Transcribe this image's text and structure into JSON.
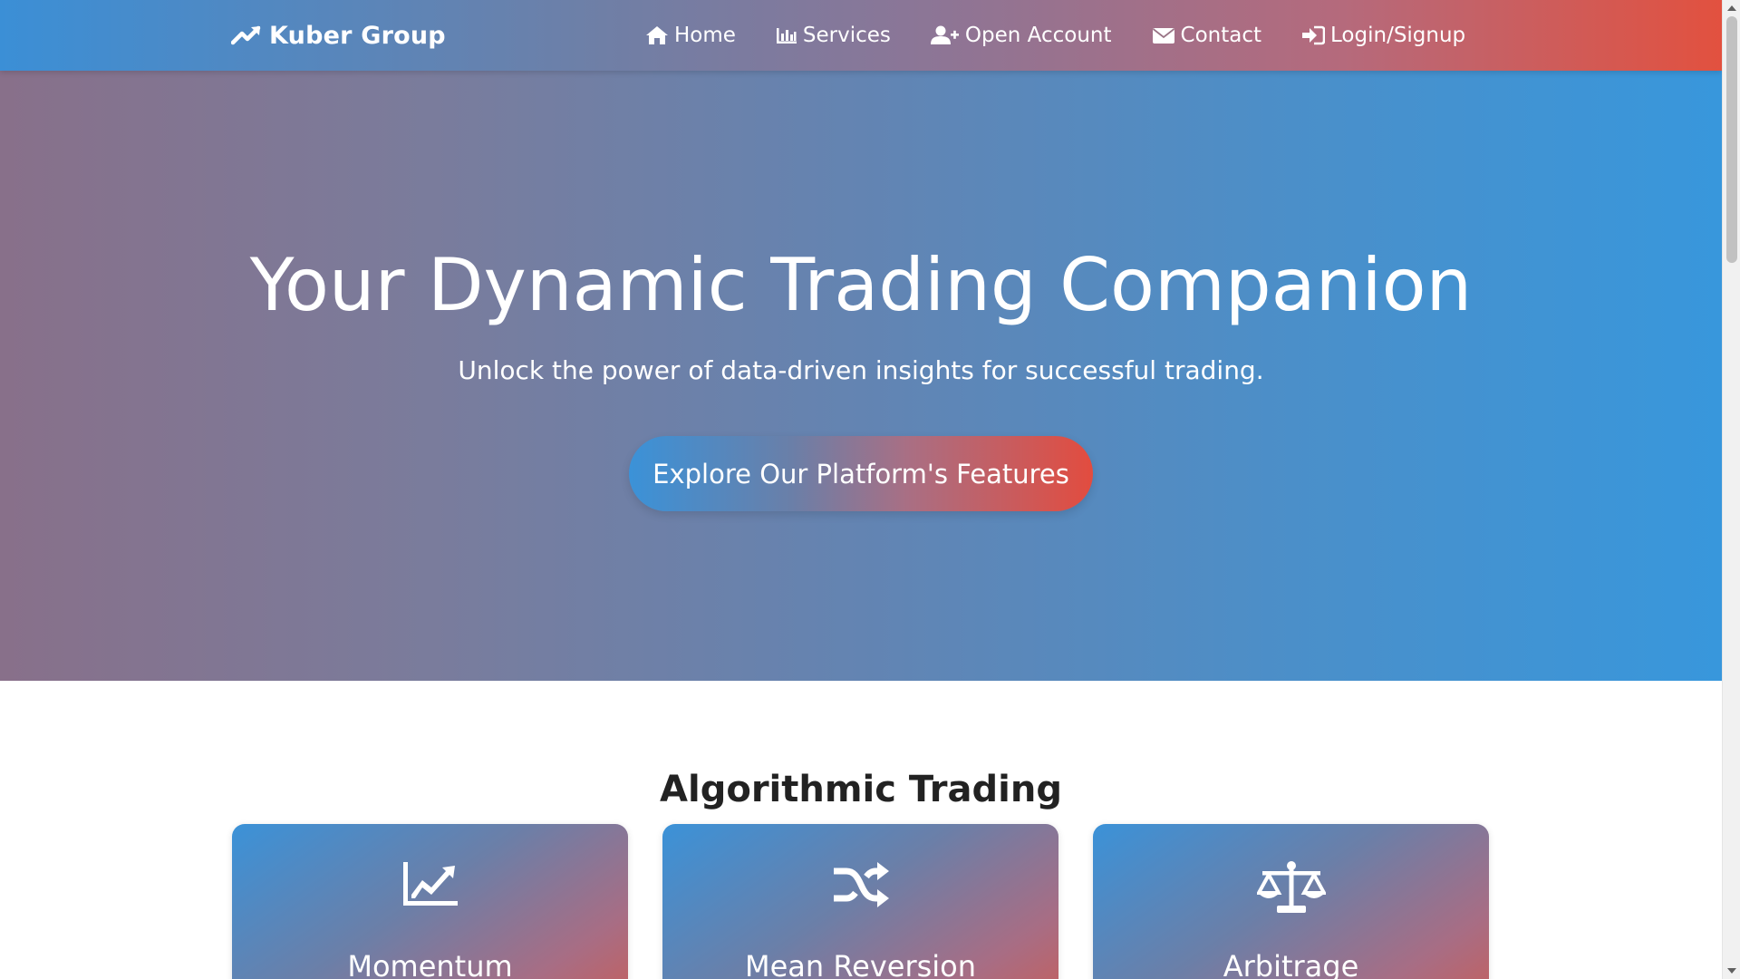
{
  "navbar": {
    "brand": "Kuber Group",
    "links": [
      {
        "label": "Home",
        "icon": "home-icon"
      },
      {
        "label": "Services",
        "icon": "bar-chart-icon"
      },
      {
        "label": "Open Account",
        "icon": "user-plus-icon"
      },
      {
        "label": "Contact",
        "icon": "envelope-icon"
      },
      {
        "label": "Login/Signup",
        "icon": "sign-in-icon"
      }
    ]
  },
  "hero": {
    "title": "Your Dynamic Trading Companion",
    "subtitle": "Unlock the power of data-driven insights for successful trading.",
    "cta_label": "Explore Our Platform's Features"
  },
  "section": {
    "title": "Algorithmic Trading",
    "cards": [
      {
        "title": "Momentum",
        "icon": "area-chart-icon"
      },
      {
        "title": "Mean Reversion",
        "icon": "shuffle-icon"
      },
      {
        "title": "Arbitrage",
        "icon": "balance-scale-icon"
      }
    ]
  },
  "colors": {
    "nav_start": "#3b8fd6",
    "nav_end": "#e2513f",
    "hero_start": "#88708a",
    "hero_end": "#3897dc",
    "accent_red": "#e24c3f",
    "accent_blue": "#3b92d8"
  }
}
